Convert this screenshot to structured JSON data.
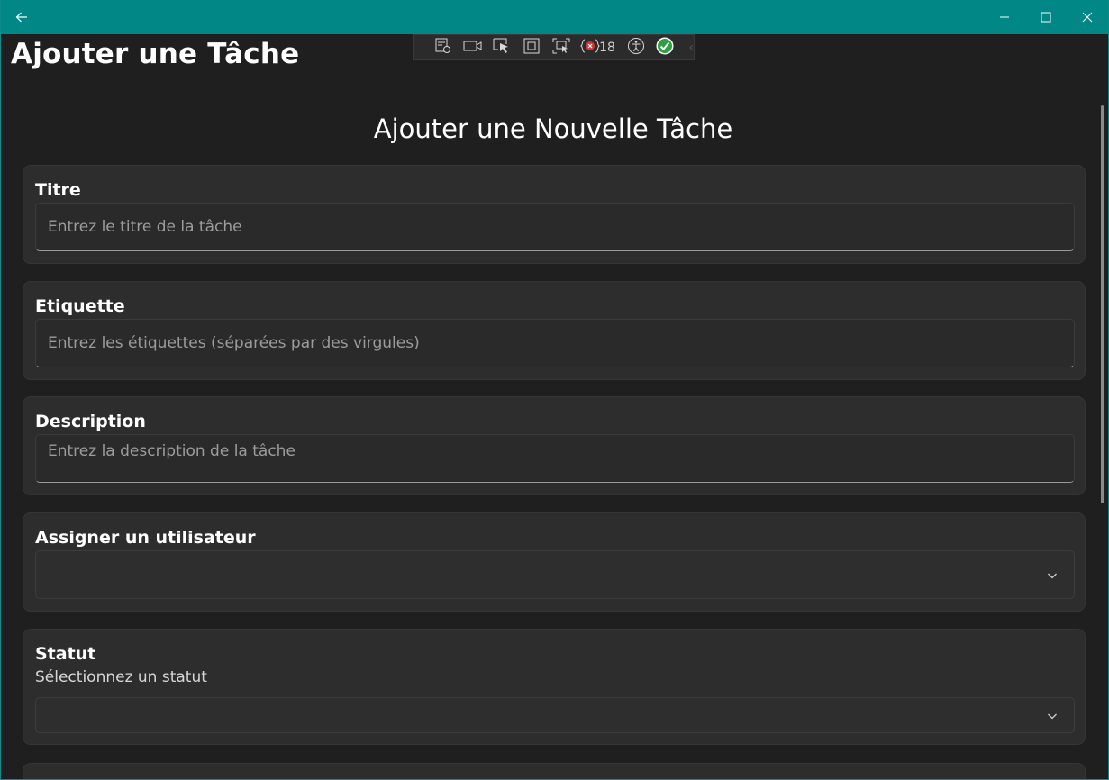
{
  "window": {
    "page_title": "Ajouter une Tâche",
    "titlebar_color": "#018786"
  },
  "debug_toolbar": {
    "error_count": "18"
  },
  "form": {
    "heading": "Ajouter une Nouvelle Tâche",
    "title_field": {
      "label": "Titre",
      "placeholder": "Entrez le titre de la tâche",
      "value": ""
    },
    "tags_field": {
      "label": "Etiquette",
      "placeholder": "Entrez les étiquettes (séparées par des virgules)",
      "value": ""
    },
    "description_field": {
      "label": "Description",
      "placeholder": "Entrez la description de la tâche",
      "value": ""
    },
    "assignee_field": {
      "label": "Assigner un utilisateur",
      "selected": ""
    },
    "status_field": {
      "label": "Statut",
      "hint": "Sélectionnez un statut",
      "selected": ""
    }
  }
}
